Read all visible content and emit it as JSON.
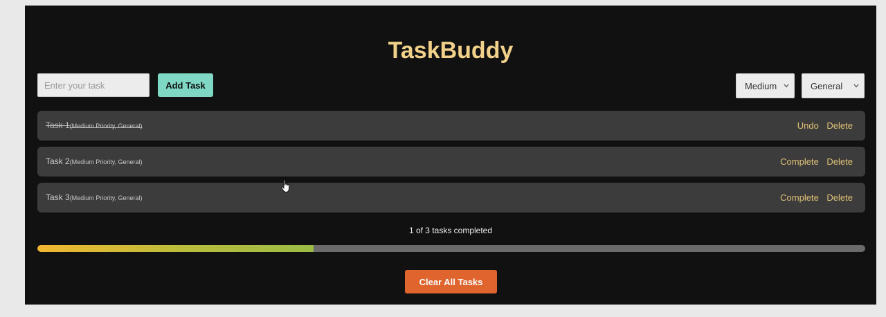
{
  "app": {
    "title": "TaskBuddy"
  },
  "form": {
    "task_placeholder": "Enter your task",
    "task_value": "",
    "add_label": "Add Task",
    "priority_selected": "Medium",
    "category_selected": "General"
  },
  "tasks": [
    {
      "name": "Task 1",
      "meta": "(Medium Priority, General)",
      "completed": true,
      "toggle_label": "Undo",
      "delete_label": "Delete"
    },
    {
      "name": "Task 2",
      "meta": "(Medium Priority, General)",
      "completed": false,
      "toggle_label": "Complete",
      "delete_label": "Delete"
    },
    {
      "name": "Task 3",
      "meta": "(Medium Priority, General)",
      "completed": false,
      "toggle_label": "Complete",
      "delete_label": "Delete"
    }
  ],
  "progress": {
    "text": "1 of 3 tasks completed",
    "completed": 1,
    "total": 3
  },
  "clear_label": "Clear All Tasks",
  "colors": {
    "title": "#f2d28a",
    "add_button": "#7fd8c4",
    "action_link": "#e0c176",
    "clear_button": "#e0642e",
    "progress_start": "#f2b730",
    "progress_end": "#9bbb45"
  }
}
